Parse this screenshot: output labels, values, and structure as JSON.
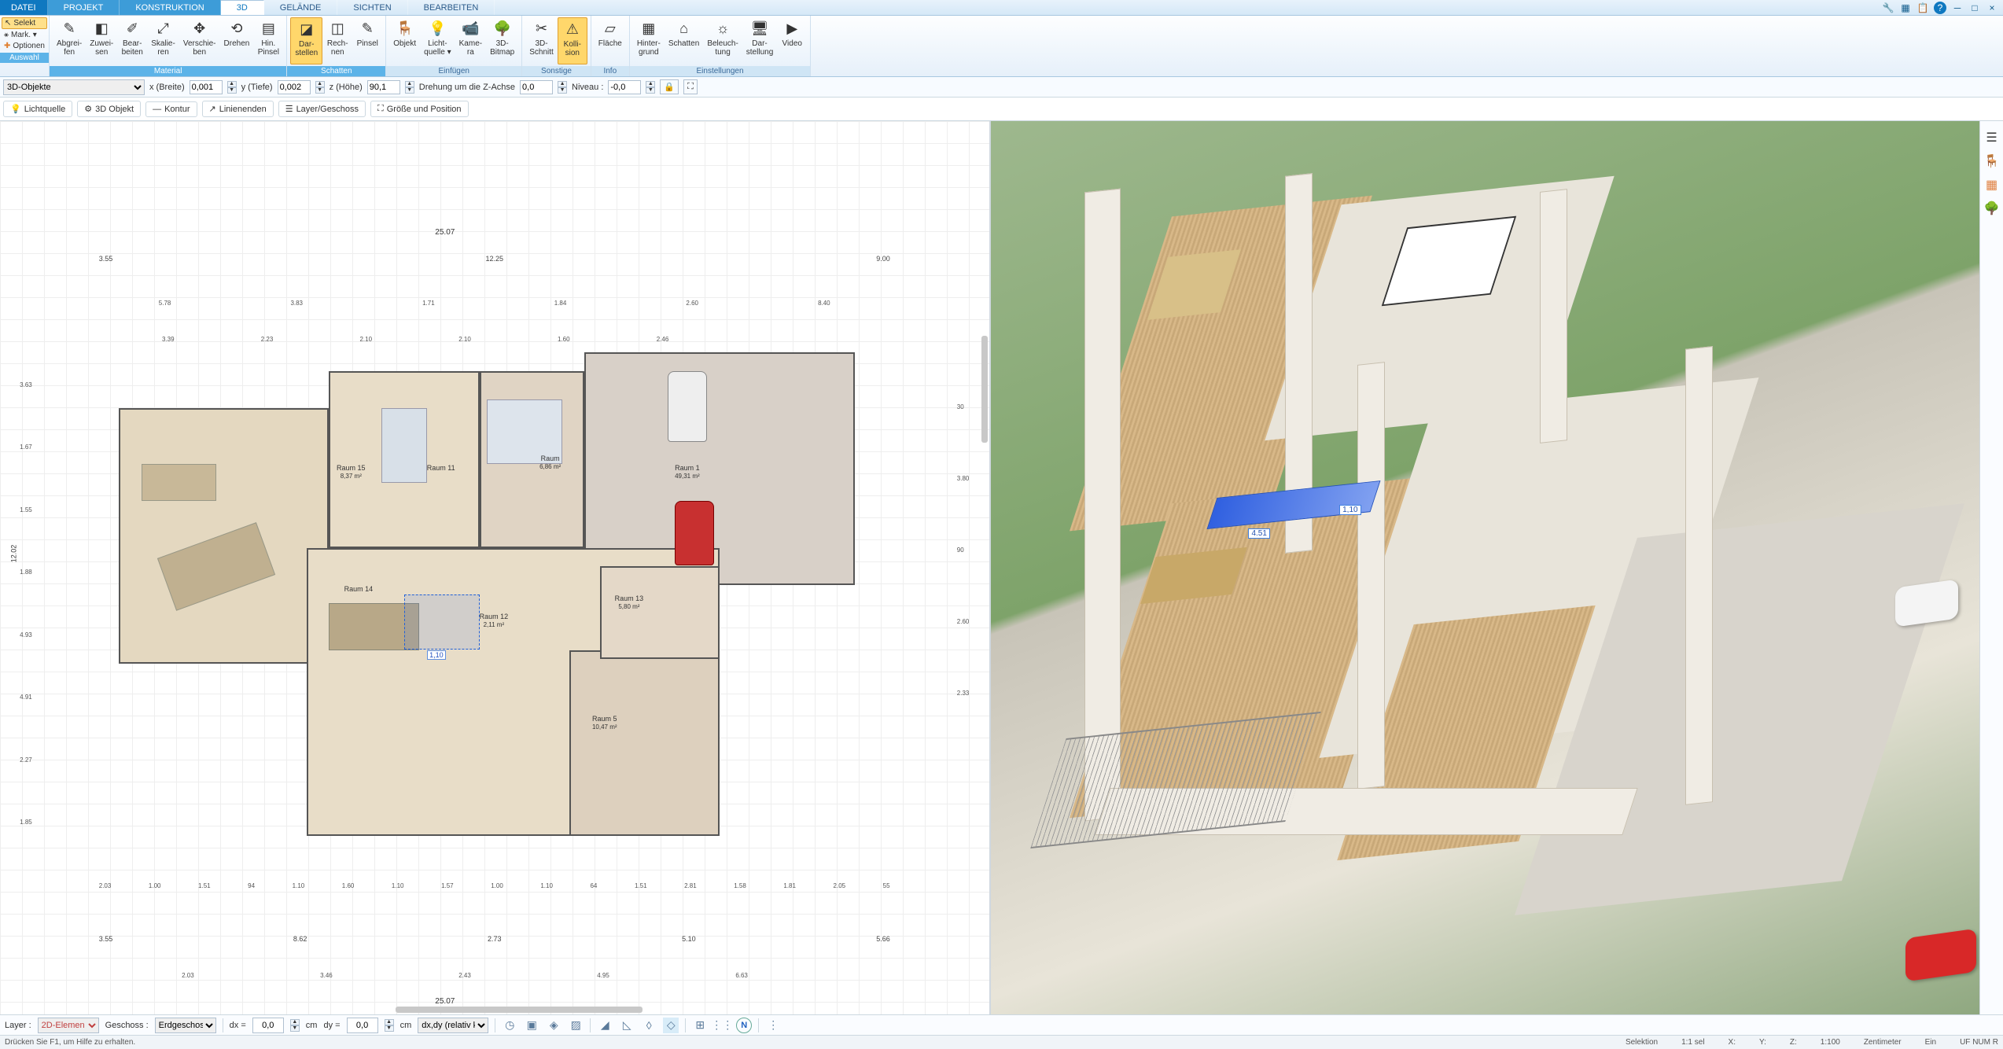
{
  "tabs": [
    "DATEI",
    "PROJEKT",
    "KONSTRUKTION",
    "3D",
    "GELÄNDE",
    "SICHTEN",
    "BEARBEITEN"
  ],
  "auswahl": {
    "selekt": "Selekt",
    "mark": "Mark. ▾",
    "optionen": "Optionen",
    "group": "Auswahl"
  },
  "ribbonGroups": [
    {
      "label": "Material",
      "cls": "",
      "items": [
        {
          "ico": "✎",
          "l1": "Abgrei-",
          "l2": "fen"
        },
        {
          "ico": "◧",
          "l1": "Zuwei-",
          "l2": "sen"
        },
        {
          "ico": "✐",
          "l1": "Bear-",
          "l2": "beiten"
        },
        {
          "ico": "⤢",
          "l1": "Skalie-",
          "l2": "ren"
        },
        {
          "ico": "✥",
          "l1": "Verschie-",
          "l2": "ben"
        },
        {
          "ico": "⟲",
          "l1": "Drehen",
          "l2": ""
        },
        {
          "ico": "▤",
          "l1": "Hin.",
          "l2": "Pinsel"
        }
      ]
    },
    {
      "label": "Schatten",
      "cls": "",
      "items": [
        {
          "ico": "◪",
          "l1": "Dar-",
          "l2": "stellen",
          "hl": true
        },
        {
          "ico": "◫",
          "l1": "Rech-",
          "l2": "nen"
        },
        {
          "ico": "✎",
          "l1": "Pinsel",
          "l2": ""
        }
      ]
    },
    {
      "label": "Einfügen",
      "cls": "",
      "items": [
        {
          "ico": "🪑",
          "l1": "Objekt",
          "l2": ""
        },
        {
          "ico": "💡",
          "l1": "Licht-",
          "l2": "quelle ▾"
        },
        {
          "ico": "📹",
          "l1": "Kame-",
          "l2": "ra"
        },
        {
          "ico": "🌳",
          "l1": "3D-",
          "l2": "Bitmap"
        }
      ]
    },
    {
      "label": "Sonstige",
      "cls": "",
      "items": [
        {
          "ico": "✂",
          "l1": "3D-",
          "l2": "Schnitt"
        },
        {
          "ico": "⚠",
          "l1": "Kolli-",
          "l2": "sion",
          "hl": true
        }
      ]
    },
    {
      "label": "Info",
      "cls": "",
      "items": [
        {
          "ico": "▱",
          "l1": "Fläche",
          "l2": ""
        }
      ]
    },
    {
      "label": "Einstellungen",
      "cls": "",
      "items": [
        {
          "ico": "▦",
          "l1": "Hinter-",
          "l2": "grund"
        },
        {
          "ico": "⌂",
          "l1": "Schatten",
          "l2": ""
        },
        {
          "ico": "☼",
          "l1": "Beleuch-",
          "l2": "tung"
        },
        {
          "ico": "🖥",
          "l1": "Dar-",
          "l2": "stellung"
        },
        {
          "ico": "▶",
          "l1": "Video",
          "l2": ""
        }
      ]
    }
  ],
  "props": {
    "typeSel": "3D-Objekte",
    "x_lbl": "x (Breite)",
    "x": "0,001",
    "y_lbl": "y (Tiefe)",
    "y": "0,002",
    "z_lbl": "z (Höhe)",
    "z": "90,1",
    "rot_lbl": "Drehung um die Z-Achse",
    "rot": "0,0",
    "niv_lbl": "Niveau :",
    "niv": "-0,0"
  },
  "secbar": [
    "Lichtquelle",
    "3D Objekt",
    "Kontur",
    "Linienenden",
    "Layer/Geschoss",
    "Größe und Position"
  ],
  "secbar_ico": [
    "💡",
    "⚙",
    "—",
    "↗",
    "☰",
    "⛶"
  ],
  "plan": {
    "rooms": [
      {
        "n": "Raum 15",
        "a": "8,37 m²"
      },
      {
        "n": "Raum 11",
        "a": ""
      },
      {
        "n": "Raum",
        "a": "6,86 m²"
      },
      {
        "n": "Raum 1",
        "a": "49,31 m²"
      },
      {
        "n": "Raum 14",
        "a": ""
      },
      {
        "n": "Raum 12",
        "a": "2,11 m²"
      },
      {
        "n": "Raum 13",
        "a": "5,80 m²"
      },
      {
        "n": "Raum 5",
        "a": "10,47 m²"
      }
    ],
    "dims_top": [
      "3.55",
      "12.25",
      "9.00"
    ],
    "dims_top2": [
      "5.78",
      "3.83",
      "1.71",
      "1.84",
      "2.60",
      "8.40"
    ],
    "dims_top3": [
      "3.39",
      "2.23",
      "2.10",
      "2.10",
      "1.60",
      "2.46"
    ],
    "dims_bottom": [
      "2.03",
      "1.00",
      "1.51",
      "94",
      "1.10",
      "1.60",
      "1.10",
      "1.57",
      "1.00",
      "1.10",
      "64",
      "1.51",
      "2.81",
      "1.58",
      "1.81",
      "2.05",
      "55"
    ],
    "dims_bottom2": [
      "3.55",
      "8.62",
      "2.73",
      "5.10",
      "5.66"
    ],
    "dims_bottom3": [
      "2.03",
      "3.46",
      "2.43",
      "4.95",
      "6.63"
    ],
    "total": "25.07",
    "total_h": "12.02",
    "left_dims": [
      "3.63",
      "1.67",
      "1.55",
      "1.88",
      "4.93",
      "4.91",
      "2.27",
      "1.85"
    ],
    "right_dims": [
      "30",
      "3.80",
      "90",
      "2.60",
      "2.33"
    ],
    "sel_dim": "1,10"
  },
  "view3d": {
    "d1": "4.51",
    "d2": "1,10"
  },
  "bottom": {
    "layer_lbl": "Layer :",
    "layer": "2D-Elemen",
    "gesch_lbl": "Geschoss :",
    "gesch": "Erdgeschos",
    "dx_lbl": "dx =",
    "dx": "0,0",
    "cm": "cm",
    "dy_lbl": "dy =",
    "dy": "0,0",
    "mode": "dx,dy (relativ ka"
  },
  "status": {
    "hint": "Drücken Sie F1, um Hilfe zu erhalten.",
    "sel": "Selektion",
    "ratio": "1:1 sel",
    "x": "X:",
    "y": "Y:",
    "z": "Z:",
    "scale": "1:100",
    "unit": "Zentimeter",
    "ein": "Ein",
    "uf": "UF",
    "num": "NUM",
    "r": "R"
  }
}
